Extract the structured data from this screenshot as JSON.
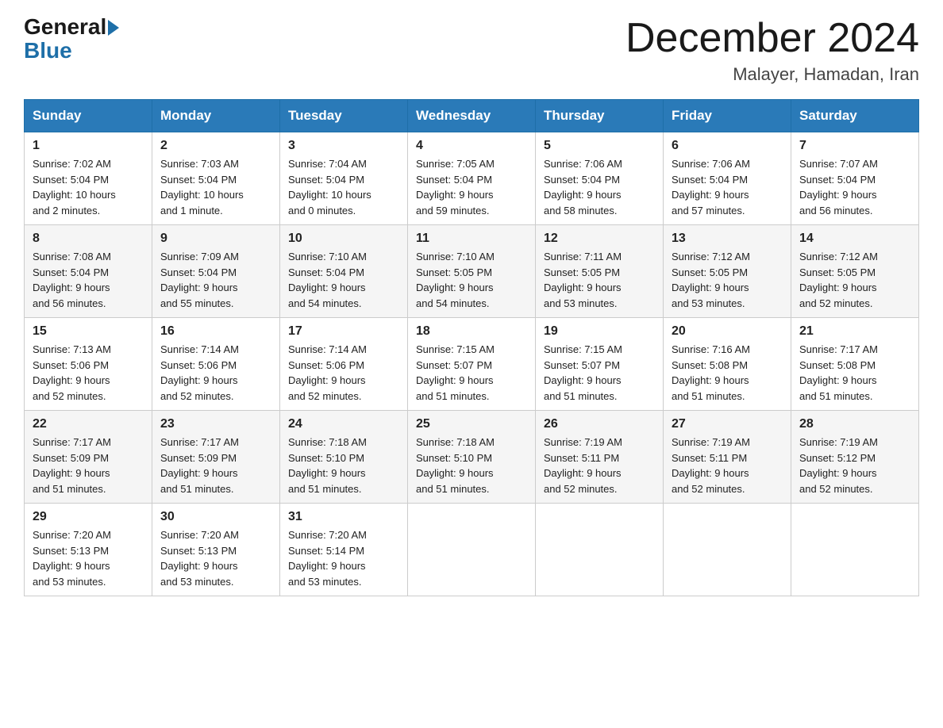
{
  "logo": {
    "general": "General",
    "blue": "Blue"
  },
  "header": {
    "month_year": "December 2024",
    "location": "Malayer, Hamadan, Iran"
  },
  "days_of_week": [
    "Sunday",
    "Monday",
    "Tuesday",
    "Wednesday",
    "Thursday",
    "Friday",
    "Saturday"
  ],
  "weeks": [
    [
      {
        "day": "1",
        "sunrise": "7:02 AM",
        "sunset": "5:04 PM",
        "daylight": "10 hours and 2 minutes."
      },
      {
        "day": "2",
        "sunrise": "7:03 AM",
        "sunset": "5:04 PM",
        "daylight": "10 hours and 1 minute."
      },
      {
        "day": "3",
        "sunrise": "7:04 AM",
        "sunset": "5:04 PM",
        "daylight": "10 hours and 0 minutes."
      },
      {
        "day": "4",
        "sunrise": "7:05 AM",
        "sunset": "5:04 PM",
        "daylight": "9 hours and 59 minutes."
      },
      {
        "day": "5",
        "sunrise": "7:06 AM",
        "sunset": "5:04 PM",
        "daylight": "9 hours and 58 minutes."
      },
      {
        "day": "6",
        "sunrise": "7:06 AM",
        "sunset": "5:04 PM",
        "daylight": "9 hours and 57 minutes."
      },
      {
        "day": "7",
        "sunrise": "7:07 AM",
        "sunset": "5:04 PM",
        "daylight": "9 hours and 56 minutes."
      }
    ],
    [
      {
        "day": "8",
        "sunrise": "7:08 AM",
        "sunset": "5:04 PM",
        "daylight": "9 hours and 56 minutes."
      },
      {
        "day": "9",
        "sunrise": "7:09 AM",
        "sunset": "5:04 PM",
        "daylight": "9 hours and 55 minutes."
      },
      {
        "day": "10",
        "sunrise": "7:10 AM",
        "sunset": "5:04 PM",
        "daylight": "9 hours and 54 minutes."
      },
      {
        "day": "11",
        "sunrise": "7:10 AM",
        "sunset": "5:05 PM",
        "daylight": "9 hours and 54 minutes."
      },
      {
        "day": "12",
        "sunrise": "7:11 AM",
        "sunset": "5:05 PM",
        "daylight": "9 hours and 53 minutes."
      },
      {
        "day": "13",
        "sunrise": "7:12 AM",
        "sunset": "5:05 PM",
        "daylight": "9 hours and 53 minutes."
      },
      {
        "day": "14",
        "sunrise": "7:12 AM",
        "sunset": "5:05 PM",
        "daylight": "9 hours and 52 minutes."
      }
    ],
    [
      {
        "day": "15",
        "sunrise": "7:13 AM",
        "sunset": "5:06 PM",
        "daylight": "9 hours and 52 minutes."
      },
      {
        "day": "16",
        "sunrise": "7:14 AM",
        "sunset": "5:06 PM",
        "daylight": "9 hours and 52 minutes."
      },
      {
        "day": "17",
        "sunrise": "7:14 AM",
        "sunset": "5:06 PM",
        "daylight": "9 hours and 52 minutes."
      },
      {
        "day": "18",
        "sunrise": "7:15 AM",
        "sunset": "5:07 PM",
        "daylight": "9 hours and 51 minutes."
      },
      {
        "day": "19",
        "sunrise": "7:15 AM",
        "sunset": "5:07 PM",
        "daylight": "9 hours and 51 minutes."
      },
      {
        "day": "20",
        "sunrise": "7:16 AM",
        "sunset": "5:08 PM",
        "daylight": "9 hours and 51 minutes."
      },
      {
        "day": "21",
        "sunrise": "7:17 AM",
        "sunset": "5:08 PM",
        "daylight": "9 hours and 51 minutes."
      }
    ],
    [
      {
        "day": "22",
        "sunrise": "7:17 AM",
        "sunset": "5:09 PM",
        "daylight": "9 hours and 51 minutes."
      },
      {
        "day": "23",
        "sunrise": "7:17 AM",
        "sunset": "5:09 PM",
        "daylight": "9 hours and 51 minutes."
      },
      {
        "day": "24",
        "sunrise": "7:18 AM",
        "sunset": "5:10 PM",
        "daylight": "9 hours and 51 minutes."
      },
      {
        "day": "25",
        "sunrise": "7:18 AM",
        "sunset": "5:10 PM",
        "daylight": "9 hours and 51 minutes."
      },
      {
        "day": "26",
        "sunrise": "7:19 AM",
        "sunset": "5:11 PM",
        "daylight": "9 hours and 52 minutes."
      },
      {
        "day": "27",
        "sunrise": "7:19 AM",
        "sunset": "5:11 PM",
        "daylight": "9 hours and 52 minutes."
      },
      {
        "day": "28",
        "sunrise": "7:19 AM",
        "sunset": "5:12 PM",
        "daylight": "9 hours and 52 minutes."
      }
    ],
    [
      {
        "day": "29",
        "sunrise": "7:20 AM",
        "sunset": "5:13 PM",
        "daylight": "9 hours and 53 minutes."
      },
      {
        "day": "30",
        "sunrise": "7:20 AM",
        "sunset": "5:13 PM",
        "daylight": "9 hours and 53 minutes."
      },
      {
        "day": "31",
        "sunrise": "7:20 AM",
        "sunset": "5:14 PM",
        "daylight": "9 hours and 53 minutes."
      },
      null,
      null,
      null,
      null
    ]
  ],
  "labels": {
    "sunrise": "Sunrise:",
    "sunset": "Sunset:",
    "daylight": "Daylight:"
  }
}
